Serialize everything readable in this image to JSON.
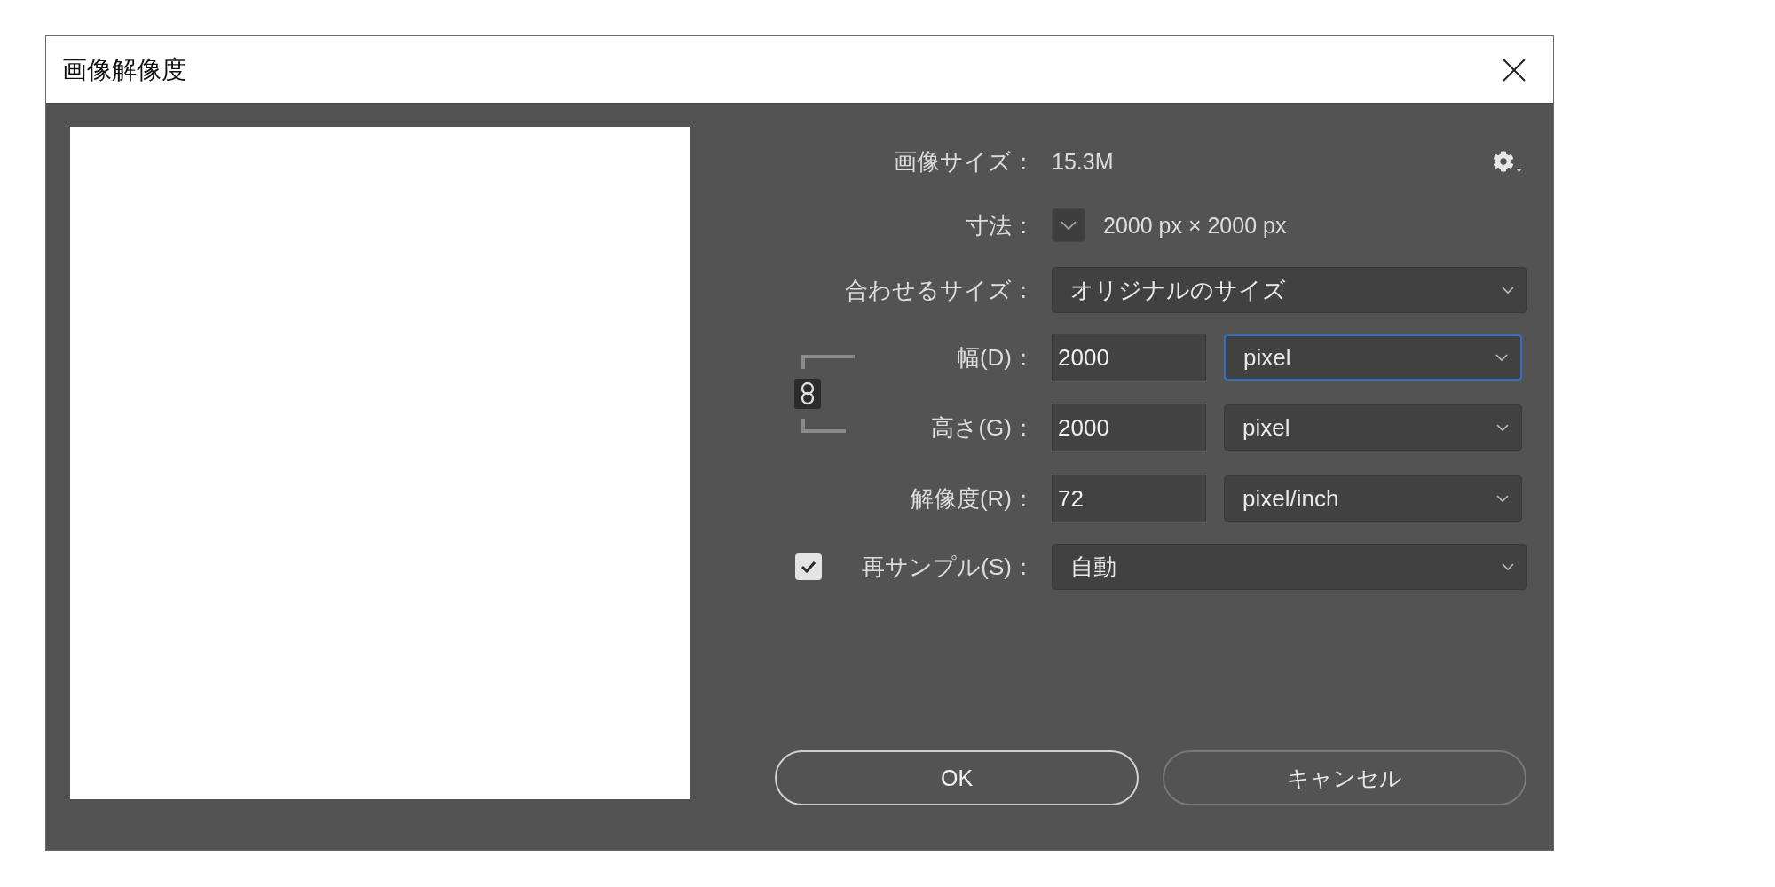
{
  "window": {
    "title": "画像解像度"
  },
  "image_size": {
    "label": "画像サイズ：",
    "value": "15.3M"
  },
  "dimensions": {
    "label": "寸法：",
    "expanded": false,
    "value": "2000 px × 2000 px"
  },
  "fit_to": {
    "label": "合わせるサイズ：",
    "value": "オリジナルのサイズ"
  },
  "constrain_proportions": {
    "on": true
  },
  "size_fields": [
    {
      "label": "幅(D)：",
      "value": "2000",
      "unit": "pixel",
      "focused": true
    },
    {
      "label": "高さ(G)：",
      "value": "2000",
      "unit": "pixel",
      "focused": false
    }
  ],
  "resolution": {
    "label": "解像度(R)：",
    "value": "72",
    "unit": "pixel/inch",
    "focused": false
  },
  "resample": {
    "label": "再サンプル(S)：",
    "checked": true,
    "value": "自動"
  },
  "buttons": [
    {
      "label": "OK",
      "default": true
    },
    {
      "label": "キャンセル",
      "default": false
    }
  ]
}
